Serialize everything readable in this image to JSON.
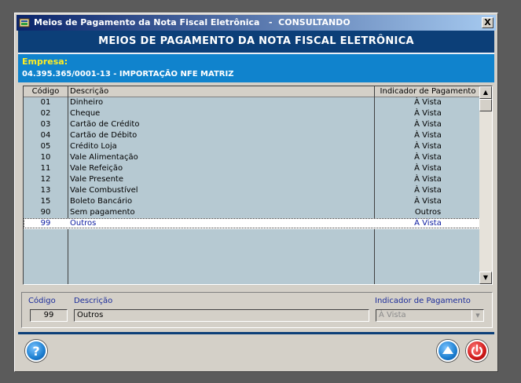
{
  "window": {
    "title": "Meios de Pagamento da Nota Fiscal Eletrônica   -  CONSULTANDO",
    "close_label": "X"
  },
  "header": {
    "title": "MEIOS DE PAGAMENTO DA NOTA FISCAL ELETRÔNICA"
  },
  "empresa": {
    "label": "Empresa:",
    "value": "04.395.365/0001-13 - IMPORTAÇÃO NFE MATRIZ"
  },
  "grid": {
    "columns": [
      "Código",
      "Descrição",
      "Indicador de Pagamento"
    ],
    "rows": [
      {
        "codigo": "01",
        "descricao": "Dinheiro",
        "indicador": "À Vista"
      },
      {
        "codigo": "02",
        "descricao": "Cheque",
        "indicador": "À Vista"
      },
      {
        "codigo": "03",
        "descricao": "Cartão de Crédito",
        "indicador": "À Vista"
      },
      {
        "codigo": "04",
        "descricao": "Cartão de Débito",
        "indicador": "À Vista"
      },
      {
        "codigo": "05",
        "descricao": "Crédito Loja",
        "indicador": "À Vista"
      },
      {
        "codigo": "10",
        "descricao": "Vale Alimentação",
        "indicador": "À Vista"
      },
      {
        "codigo": "11",
        "descricao": "Vale Refeição",
        "indicador": "À Vista"
      },
      {
        "codigo": "12",
        "descricao": "Vale Presente",
        "indicador": "À Vista"
      },
      {
        "codigo": "13",
        "descricao": "Vale Combustível",
        "indicador": "À Vista"
      },
      {
        "codigo": "15",
        "descricao": "Boleto Bancário",
        "indicador": "À Vista"
      },
      {
        "codigo": "90",
        "descricao": "Sem pagamento",
        "indicador": "Outros"
      },
      {
        "codigo": "99",
        "descricao": "Outros",
        "indicador": "À Vista"
      }
    ],
    "selected_index": 11
  },
  "detail": {
    "codigo_label": "Código",
    "descricao_label": "Descrição",
    "indicador_label": "Indicador de Pagamento",
    "codigo_value": "99",
    "descricao_value": "Outros",
    "indicador_value": "À Vista"
  },
  "colors": {
    "header_bg": "#0c3f78",
    "empresa_bg": "#1083cd",
    "empresa_label": "#ffee22",
    "grid_bg": "#b6c9d2",
    "help_button": "#1d7fd0",
    "up_button": "#1d7fd0",
    "power_button": "#d01818"
  },
  "icons": {
    "help": "question-mark-icon",
    "up": "up-arrow-icon",
    "power": "power-icon"
  }
}
